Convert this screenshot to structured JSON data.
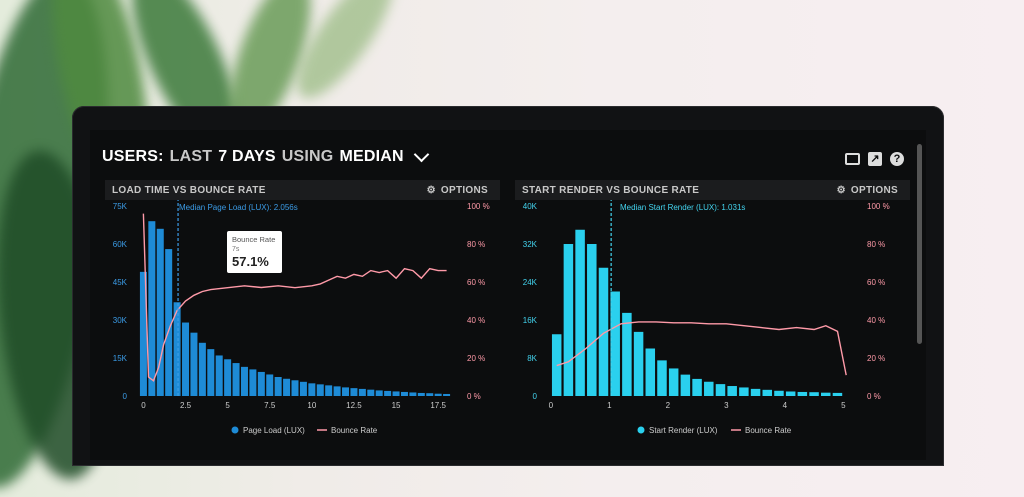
{
  "header": {
    "users": "USERS:",
    "last": "LAST",
    "days": "7 DAYS",
    "using": "USING",
    "metric": "MEDIAN"
  },
  "icons": [
    "monitor-icon",
    "share-icon",
    "help-icon"
  ],
  "colors": {
    "bars_left": "#1e8bd6",
    "bars_right": "#2ad0ee",
    "line": "#ff9aa8",
    "accent_left": "#3b9be6",
    "accent_right": "#43d3ee"
  },
  "panels": [
    {
      "title": "LOAD TIME VS BOUNCE RATE",
      "options_label": "OPTIONS",
      "median_label": "Median Page Load (LUX): 2.056s",
      "median_x": 2.056,
      "y_ticks": [
        "75K",
        "60K",
        "45K",
        "30K",
        "15K",
        "0"
      ],
      "y2_ticks": [
        "100 %",
        "80 %",
        "60 %",
        "40 %",
        "20 %",
        "0 %"
      ],
      "x_ticks": [
        "0",
        "2.5",
        "5",
        "7.5",
        "10",
        "12.5",
        "15",
        "17.5"
      ],
      "legend": [
        "Page Load (LUX)",
        "Bounce Rate"
      ],
      "tooltip": {
        "label": "Bounce Rate",
        "sub": "7s",
        "value": "57.1%"
      }
    },
    {
      "title": "START RENDER VS BOUNCE RATE",
      "options_label": "OPTIONS",
      "median_label": "Median Start Render (LUX): 1.031s",
      "median_x": 1.031,
      "y_ticks": [
        "40K",
        "32K",
        "24K",
        "16K",
        "8K",
        "0"
      ],
      "y2_ticks": [
        "100 %",
        "80 %",
        "60 %",
        "40 %",
        "20 %",
        "0 %"
      ],
      "x_ticks": [
        "0",
        "1",
        "2",
        "3",
        "4",
        "5"
      ],
      "legend": [
        "Start Render (LUX)",
        "Bounce Rate"
      ]
    }
  ],
  "chart_data": [
    {
      "type": "bar",
      "xlim": [
        -0.5,
        18.5
      ],
      "ylim": [
        0,
        75000
      ],
      "y2lim": [
        0,
        100
      ],
      "bars": {
        "name": "Page Load (LUX)",
        "x": [
          0,
          0.5,
          1,
          1.5,
          2,
          2.5,
          3,
          3.5,
          4,
          4.5,
          5,
          5.5,
          6,
          6.5,
          7,
          7.5,
          8,
          8.5,
          9,
          9.5,
          10,
          10.5,
          11,
          11.5,
          12,
          12.5,
          13,
          13.5,
          14,
          14.5,
          15,
          15.5,
          16,
          16.5,
          17,
          17.5,
          18
        ],
        "values": [
          49000,
          69000,
          66000,
          58000,
          37000,
          29000,
          25000,
          21000,
          18500,
          16000,
          14500,
          13000,
          11500,
          10500,
          9500,
          8500,
          7500,
          6800,
          6200,
          5600,
          5000,
          4600,
          4200,
          3800,
          3400,
          3100,
          2800,
          2500,
          2200,
          2000,
          1800,
          1600,
          1400,
          1200,
          1100,
          900,
          800
        ]
      },
      "line": {
        "name": "Bounce Rate",
        "x": [
          0,
          0.3,
          0.6,
          0.9,
          1.2,
          1.6,
          2,
          2.5,
          3,
          3.5,
          4,
          5,
          6,
          7,
          8,
          9,
          10,
          10.5,
          11,
          11.5,
          12,
          12.5,
          13,
          13.5,
          14,
          14.5,
          15,
          15.5,
          16,
          16.5,
          17,
          17.5,
          18
        ],
        "values": [
          96,
          10,
          8,
          15,
          27,
          37,
          45,
          50,
          53,
          55,
          56,
          57,
          58,
          57.1,
          58,
          57,
          58,
          59,
          61,
          63,
          62,
          64,
          63,
          66,
          65,
          66,
          62,
          67,
          66,
          62,
          67,
          66,
          66
        ]
      }
    },
    {
      "type": "bar",
      "xlim": [
        -0.1,
        5.2
      ],
      "ylim": [
        0,
        40000
      ],
      "y2lim": [
        0,
        100
      ],
      "bars": {
        "name": "Start Render (LUX)",
        "x": [
          0.1,
          0.3,
          0.5,
          0.7,
          0.9,
          1.1,
          1.3,
          1.5,
          1.7,
          1.9,
          2.1,
          2.3,
          2.5,
          2.7,
          2.9,
          3.1,
          3.3,
          3.5,
          3.7,
          3.9,
          4.1,
          4.3,
          4.5,
          4.7,
          4.9
        ],
        "values": [
          13000,
          32000,
          35000,
          32000,
          27000,
          22000,
          17500,
          13500,
          10000,
          7500,
          5800,
          4500,
          3600,
          3000,
          2500,
          2100,
          1800,
          1500,
          1300,
          1100,
          950,
          850,
          800,
          700,
          650
        ]
      },
      "line": {
        "name": "Bounce Rate",
        "x": [
          0.1,
          0.3,
          0.6,
          0.9,
          1.2,
          1.5,
          1.8,
          2.1,
          2.4,
          2.7,
          3,
          3.3,
          3.6,
          3.9,
          4.2,
          4.5,
          4.7,
          4.9,
          5.05
        ],
        "values": [
          16,
          18,
          25,
          33,
          38,
          39,
          39,
          38.5,
          38.5,
          38,
          38,
          37,
          36,
          35,
          36,
          35,
          37,
          34,
          11
        ]
      }
    }
  ]
}
